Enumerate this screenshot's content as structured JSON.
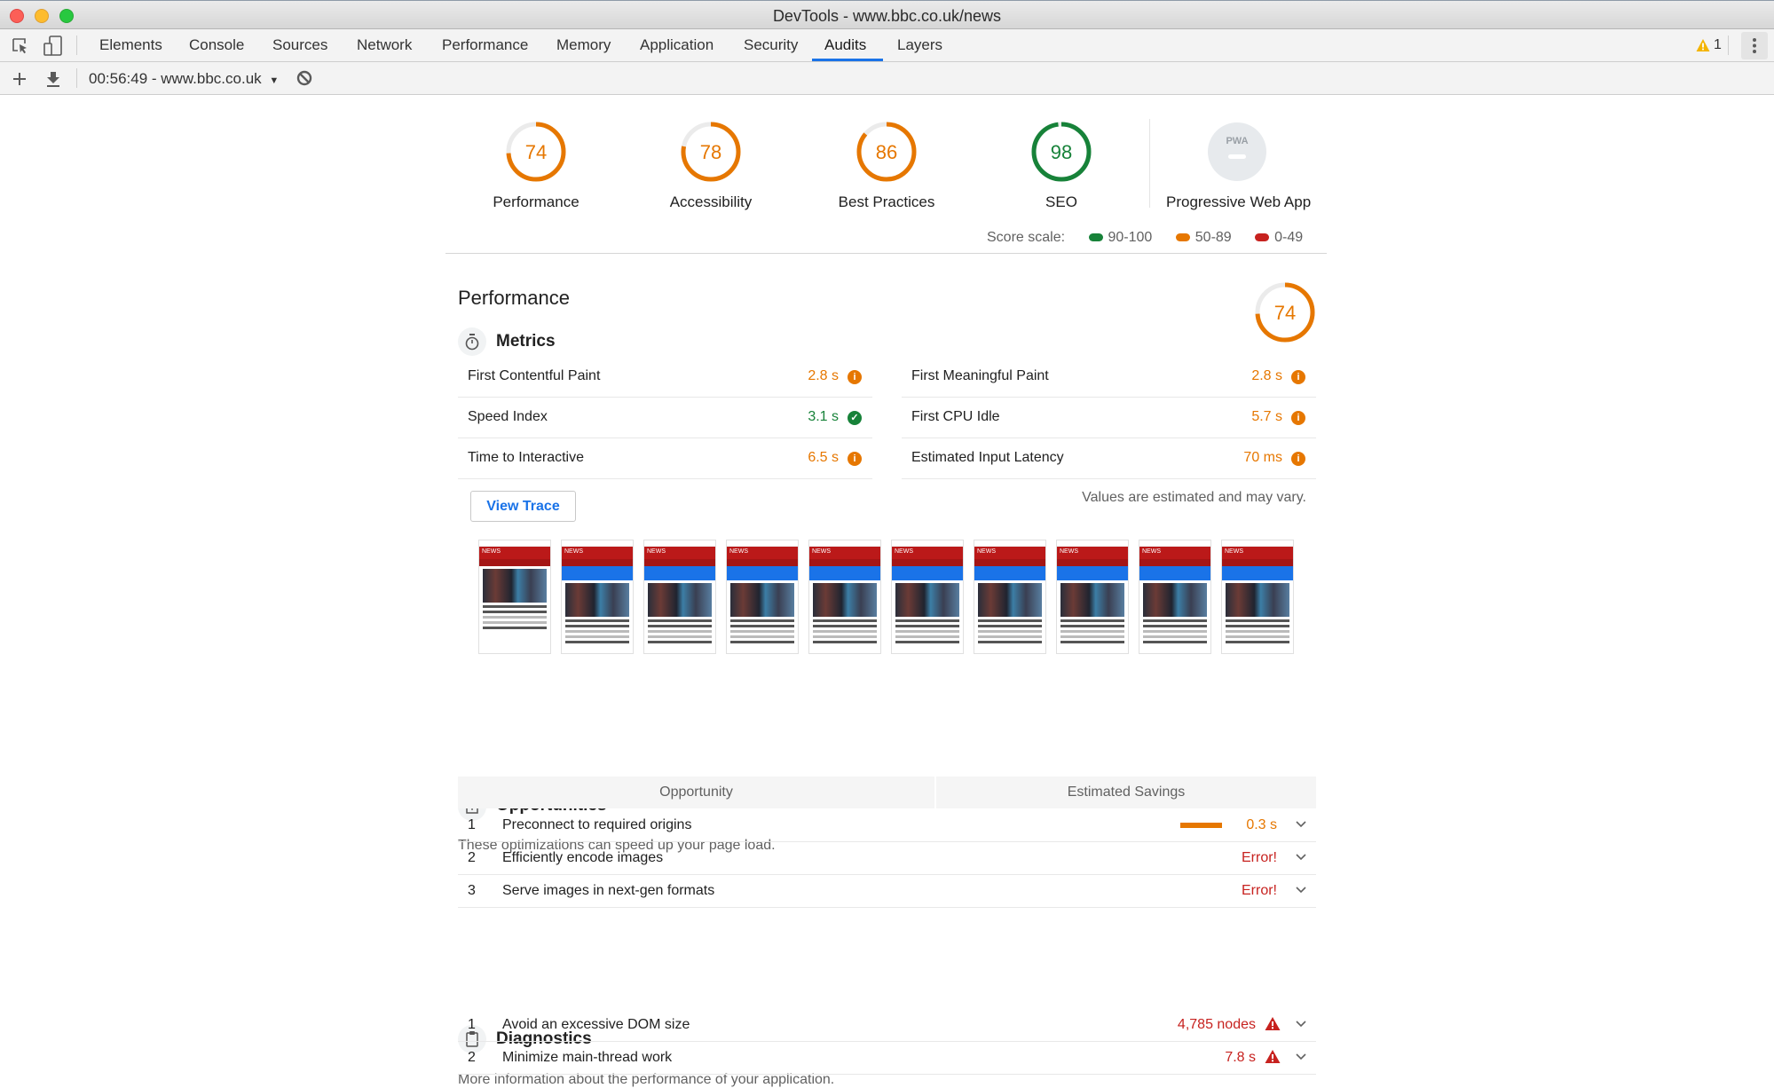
{
  "window": {
    "title": "DevTools - www.bbc.co.uk/news"
  },
  "tabs": [
    {
      "label": "Elements",
      "active": false
    },
    {
      "label": "Console",
      "active": false
    },
    {
      "label": "Sources",
      "active": false
    },
    {
      "label": "Network",
      "active": false
    },
    {
      "label": "Performance",
      "active": false
    },
    {
      "label": "Memory",
      "active": false
    },
    {
      "label": "Application",
      "active": false
    },
    {
      "label": "Security",
      "active": false
    },
    {
      "label": "Audits",
      "active": true
    },
    {
      "label": "Layers",
      "active": false
    }
  ],
  "tabbar_right": {
    "warning_count": "1",
    "warning_icon": "warning-triangle-icon",
    "menu_icon": "kebab-menu-icon"
  },
  "toolbar": {
    "report_selector": "00:56:49 - www.bbc.co.uk",
    "icons": [
      "plus-icon",
      "download-icon",
      "clear-icon"
    ]
  },
  "colors": {
    "pass": "#178239",
    "average": "#e67700",
    "fail": "#c7221f",
    "accent": "#1a73e8"
  },
  "scores": [
    {
      "label": "Performance",
      "value": 74,
      "rating": "average"
    },
    {
      "label": "Accessibility",
      "value": 78,
      "rating": "average"
    },
    {
      "label": "Best Practices",
      "value": 86,
      "rating": "average"
    },
    {
      "label": "SEO",
      "value": 98,
      "rating": "pass"
    },
    {
      "label": "Progressive Web App",
      "value": null,
      "badge": "PWA",
      "rating": "na"
    }
  ],
  "score_scale": {
    "label": "Score scale:",
    "ranges": [
      {
        "label": "90-100",
        "rating": "pass"
      },
      {
        "label": "50-89",
        "rating": "average"
      },
      {
        "label": "0-49",
        "rating": "fail"
      }
    ]
  },
  "performance": {
    "title": "Performance",
    "score": 74,
    "metrics_title": "Metrics",
    "metrics": [
      {
        "label": "First Contentful Paint",
        "value": "2.8 s",
        "rating": "average"
      },
      {
        "label": "First Meaningful Paint",
        "value": "2.8 s",
        "rating": "average"
      },
      {
        "label": "Speed Index",
        "value": "3.1 s",
        "rating": "pass"
      },
      {
        "label": "First CPU Idle",
        "value": "5.7 s",
        "rating": "average"
      },
      {
        "label": "Time to Interactive",
        "value": "6.5 s",
        "rating": "average"
      },
      {
        "label": "Estimated Input Latency",
        "value": "70 ms",
        "rating": "average"
      }
    ],
    "view_trace_label": "View Trace",
    "estimate_note": "Values are estimated and may vary.",
    "filmstrip_frames": 10
  },
  "opportunities": {
    "title": "Opportunities",
    "description": "These optimizations can speed up your page load.",
    "col_opportunity": "Opportunity",
    "col_savings": "Estimated Savings",
    "items": [
      {
        "num": "1",
        "title": "Preconnect to required origins",
        "value": "0.3 s",
        "rating": "average",
        "bar_fraction": 1.0
      },
      {
        "num": "2",
        "title": "Efficiently encode images",
        "value": "Error!",
        "rating": "fail"
      },
      {
        "num": "3",
        "title": "Serve images in next-gen formats",
        "value": "Error!",
        "rating": "fail"
      }
    ]
  },
  "diagnostics": {
    "title": "Diagnostics",
    "description": "More information about the performance of your application.",
    "items": [
      {
        "num": "1",
        "title": "Avoid an excessive DOM size",
        "value": "4,785 nodes",
        "rating": "fail"
      },
      {
        "num": "2",
        "title": "Minimize main-thread work",
        "value": "7.8 s",
        "rating": "fail"
      }
    ]
  }
}
